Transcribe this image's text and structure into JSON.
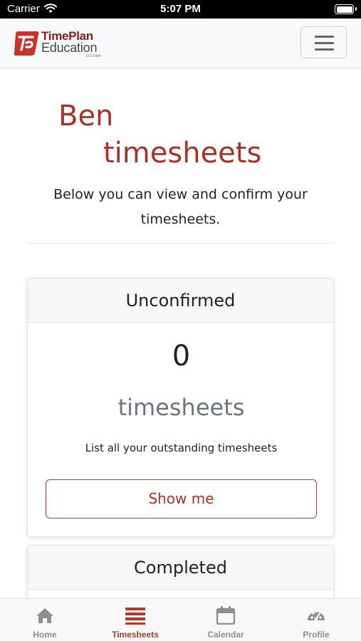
{
  "status_bar": {
    "carrier": "Carrier",
    "time": "5:07 PM"
  },
  "navbar": {
    "logo_line1": "TimePlan",
    "logo_line2": "Education",
    "logo_est": "EST.1989",
    "menu_icon": "hamburger-icon"
  },
  "header": {
    "name": "Ben",
    "title": "timesheets",
    "intro": "Below you can view and confirm your timesheets."
  },
  "cards": [
    {
      "header": "Unconfirmed",
      "count": "0",
      "unit": "timesheets",
      "description": "List all your outstanding timesheets",
      "button": "Show me"
    },
    {
      "header": "Completed"
    }
  ],
  "tabbar": {
    "active": "Timesheets",
    "active_color": "#b03a2e",
    "inactive_color": "#8e8e8e",
    "tabs": [
      {
        "label": "Home",
        "icon": "home-icon"
      },
      {
        "label": "Timesheets",
        "icon": "list-icon"
      },
      {
        "label": "Calendar",
        "icon": "calendar-icon"
      },
      {
        "label": "Profile",
        "icon": "dashboard-icon"
      }
    ]
  },
  "colors": {
    "accent": "#a8322a",
    "muted": "#6c757d"
  }
}
